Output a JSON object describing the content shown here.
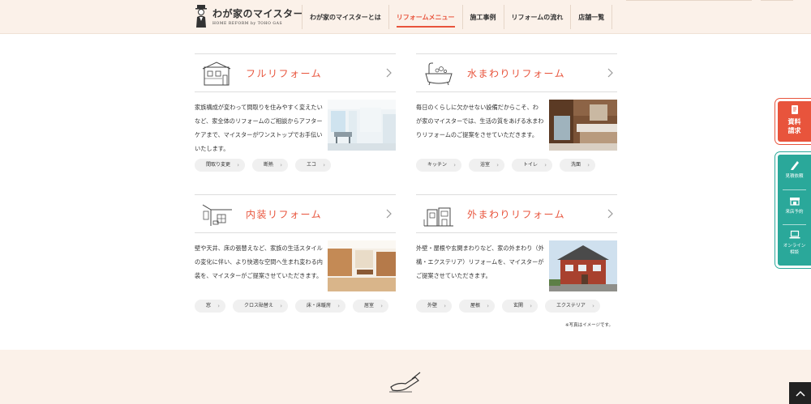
{
  "header": {
    "logo_main": "わが家のマイスター",
    "logo_sub": "HOME REFORM by TOHO GAS",
    "nav": [
      {
        "label": "わが家のマイスターとは",
        "active": false
      },
      {
        "label": "リフォームメニュー",
        "active": true
      },
      {
        "label": "施工事例",
        "active": false
      },
      {
        "label": "リフォームの流れ",
        "active": false
      },
      {
        "label": "店舗一覧",
        "active": false
      }
    ]
  },
  "cards": [
    {
      "title": "フルリフォーム",
      "illust": "house-illustration",
      "desc": "家族構成が変わって間取りを住みやすく変えたいなど、家全体のリフォームのご相談からアフターケアまで、マイスターがワンストップでお手伝いいたします。",
      "photo": "white-living-room-photo",
      "tags": [
        "間取り変更",
        "断熱",
        "エコ"
      ]
    },
    {
      "title": "水まわりリフォーム",
      "illust": "bathtub-illustration",
      "desc": "毎日のくらしに欠かせない設備だからこそ、わが家のマイスターでは、生活の質をあげる水まわりリフォームのご提案をさせていただきます。",
      "photo": "bathroom-photo",
      "tags": [
        "キッチン",
        "浴室",
        "トイレ",
        "洗面"
      ]
    },
    {
      "title": "内装リフォーム",
      "illust": "room-interior-illustration",
      "desc": "壁や天井、床の張替えなど、家族の生活スタイルの変化に伴い、より快適な空間へ生まれ変わる内装を、マイスターがご提案させていただきます。",
      "photo": "wood-interior-photo",
      "tags": [
        "窓",
        "クロス貼替え",
        "床・床暖房",
        "居室"
      ]
    },
    {
      "title": "外まわりリフォーム",
      "illust": "exterior-illustration",
      "desc": "外壁・屋根や玄関まわりなど、家の外まわり（外構・エクステリア）リフォームを、マイスターがご提案させていただきます。",
      "photo": "house-exterior-photo",
      "tags": [
        "外壁",
        "屋根",
        "玄関",
        "エクステリア"
      ]
    }
  ],
  "note": "※写真はイメージです。",
  "side": {
    "document_request": "資料請求",
    "estimate": "見積依頼",
    "visit": "来店予約",
    "online": "オンライン相談"
  },
  "colors": {
    "accent": "#e8543c",
    "teal": "#2aa89a",
    "header_bg": "#fbf1e9"
  }
}
